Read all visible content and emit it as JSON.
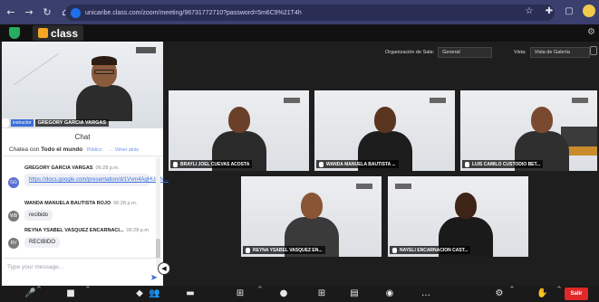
{
  "browser": {
    "url": "unicaribe.class.com/zoom/meeting/96731772710?password=5m6C9%21T4h",
    "nav_icons": [
      "back-icon",
      "forward-icon",
      "reload-icon",
      "home-icon"
    ]
  },
  "app": {
    "logo_text": "class"
  },
  "controls": {
    "room_label": "Organización de Sala:",
    "room_value": "General",
    "view_label": "Vista:",
    "view_value": "Vista de Galería"
  },
  "sidebar": {
    "self_tag": "instructor",
    "self_name": "GREGORY GARCIA VARGAS",
    "chat_title": "Chat",
    "chat_with_prefix": "Chatea con",
    "chat_with_target": "Todo el mundo",
    "chat_public": "Público",
    "chat_back": "← Volver atrás",
    "messages": [
      {
        "author": "GREGORY GARCIA VARGAS",
        "time": "06:28 p.m.",
        "text": "https://docs.google.com/presentation/d/1Vvm4AqHUkrN...",
        "avatar": "GG",
        "color": "#5b6fd3"
      },
      {
        "author": "WANDA MANUELA BAUTISTA ROJO",
        "time": "06:28 p.m.",
        "text": "recibido",
        "avatar": "WB",
        "color": "#7a7a7a"
      },
      {
        "author": "REYNA YSABEL VASQUEZ ENCARNACI...",
        "time": "06:28 p.m.",
        "text": "RECIBIDO",
        "avatar": "RV",
        "color": "#7a7a7a"
      }
    ],
    "input_placeholder": "Type your message..."
  },
  "tiles": [
    {
      "name": "BRAYLI JOEL CUEVAS ACOSTA",
      "skin": "#6b4029",
      "shirt": "#2a2a2a"
    },
    {
      "name": "WANDA MANUELA BAUTISTA ...",
      "skin": "#5a3520",
      "shirt": "#1d1d1d"
    },
    {
      "name": "LUIS CAMILO CUSTODIO BET...",
      "skin": "#7a4a30",
      "shirt": "#2f2f2f"
    },
    {
      "name": "REYNA YSABEL VASQUEZ EN...",
      "skin": "#8a5535",
      "shirt": "#3a3a3a"
    },
    {
      "name": "NAYELI ENCARNACION CAST...",
      "skin": "#3e2416",
      "shirt": "#1a1a1a"
    }
  ],
  "toolbar": {
    "leave_label": "Salir"
  }
}
